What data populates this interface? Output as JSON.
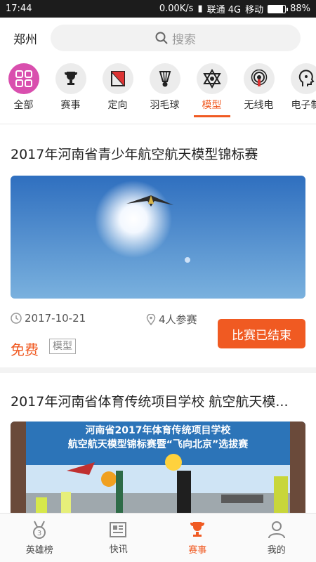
{
  "status_bar": {
    "time": "17:44",
    "network_speed": "0.00K/s",
    "carrier1": "联通 4G",
    "carrier2": "移动",
    "battery": "88%",
    "battery_level": 0.88
  },
  "header": {
    "city": "郑州",
    "search_placeholder": "搜索"
  },
  "categories": [
    {
      "label": "全部",
      "icon": "grid-icon"
    },
    {
      "label": "赛事",
      "icon": "trophy-icon"
    },
    {
      "label": "定向",
      "icon": "orienteering-flag-icon"
    },
    {
      "label": "羽毛球",
      "icon": "shuttlecock-icon"
    },
    {
      "label": "模型",
      "icon": "model-hexagram-icon",
      "active": true
    },
    {
      "label": "无线电",
      "icon": "radio-signal-icon"
    },
    {
      "label": "电子制",
      "icon": "electronics-head-icon"
    }
  ],
  "cards": [
    {
      "title": "2017年河南省青少年航空航天模型锦标赛",
      "date": "2017-10-21",
      "participants": "4人参赛",
      "price": "免费",
      "tag": "模型",
      "status": "比赛已结束"
    },
    {
      "title": "2017年河南省体育传统项目学校 航空航天模...",
      "banner_line1": "河南省2017年体育传统项目学校",
      "banner_line2": "航空航天模型锦标赛暨“飞向北京”选拔赛"
    }
  ],
  "tabbar": [
    {
      "label": "英雄榜",
      "icon": "medal-icon"
    },
    {
      "label": "快讯",
      "icon": "news-icon"
    },
    {
      "label": "赛事",
      "icon": "trophy-icon",
      "active": true
    },
    {
      "label": "我的",
      "icon": "user-icon"
    }
  ],
  "colors": {
    "accent": "#f05a22",
    "all_icon": "#d94fae"
  }
}
